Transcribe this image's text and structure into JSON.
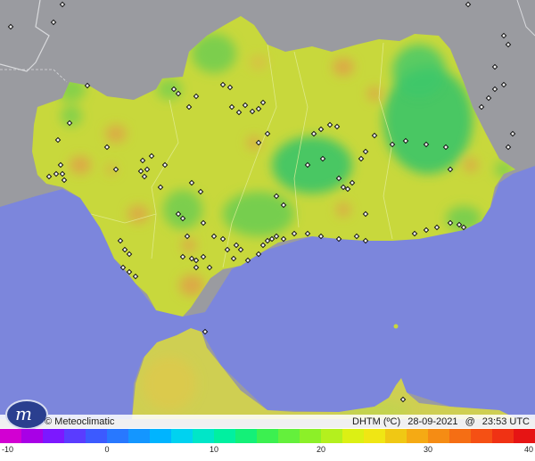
{
  "map": {
    "sea_color": "#7c86dc",
    "land_color": "#9a9ba0",
    "region_base_color": "#c8d83c",
    "warm_color": "#e39a4a",
    "cool_color": "#34c36a"
  },
  "logo": {
    "icon": "meteoclimatic-logo",
    "mark": "m"
  },
  "brand": {
    "label": "© Meteoclimatic"
  },
  "caption": {
    "variable": "DHTM (ºC)",
    "date": "28-09-2021",
    "at": "@",
    "time": "23:53 UTC"
  },
  "legend": {
    "ticks": [
      "-10",
      "0",
      "10",
      "20",
      "30",
      "40"
    ],
    "colors": [
      "#d200d2",
      "#a800e6",
      "#7c18ff",
      "#5a3cff",
      "#3c5aff",
      "#2878ff",
      "#1496ff",
      "#00b4ff",
      "#00d2f0",
      "#00e6c8",
      "#00f0a0",
      "#14f078",
      "#3cf050",
      "#64f03c",
      "#8cf028",
      "#b4f01e",
      "#dcf014",
      "#f0e614",
      "#f0c814",
      "#f5aa14",
      "#f58c14",
      "#f56e14",
      "#f55014",
      "#f03214",
      "#e61414"
    ]
  }
}
